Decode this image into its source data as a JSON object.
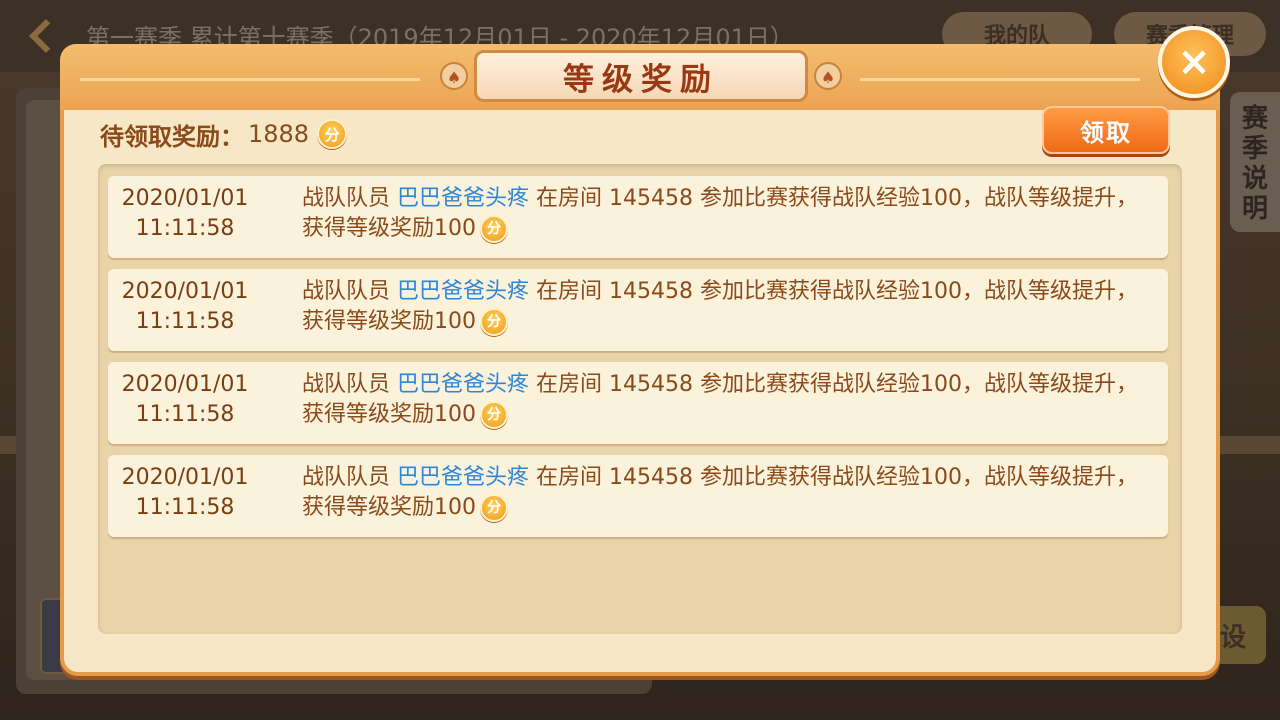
{
  "background": {
    "title": "第一赛季   累计第十赛季（2019年12月01日 - 2020年12月01日）",
    "button_1": "我的队",
    "button_2": "赛季管理",
    "side_tab": "赛季说明",
    "bottom_button": "设"
  },
  "dialog": {
    "title": "等级奖励",
    "close_icon": "×",
    "pending_label": "待领取奖励：",
    "pending_value": "1888",
    "coin_icon_label": "分",
    "claim_button": "领取",
    "rows": [
      {
        "date": "2020/01/01",
        "time": "11:11:58",
        "prefix": "战队队员 ",
        "member": "巴巴爸爸头疼",
        "middle": " 在房间 145458  参加比赛获得战队经验100，战队等级提升，获得等级奖励100"
      },
      {
        "date": "2020/01/01",
        "time": "11:11:58",
        "prefix": "战队队员 ",
        "member": "巴巴爸爸头疼",
        "middle": " 在房间 145458  参加比赛获得战队经验100，战队等级提升，获得等级奖励100"
      },
      {
        "date": "2020/01/01",
        "time": "11:11:58",
        "prefix": "战队队员 ",
        "member": "巴巴爸爸头疼",
        "middle": " 在房间 145458  参加比赛获得战队经验100，战队等级提升，获得等级奖励100"
      },
      {
        "date": "2020/01/01",
        "time": "11:11:58",
        "prefix": "战队队员 ",
        "member": "巴巴爸爸头疼",
        "middle": " 在房间 145458  参加比赛获得战队经验100，战队等级提升，获得等级奖励100"
      }
    ]
  },
  "colors": {
    "accent_orange": "#f06a15",
    "member_name_blue": "#2f86d8",
    "text_brown": "#8a4a1a"
  }
}
